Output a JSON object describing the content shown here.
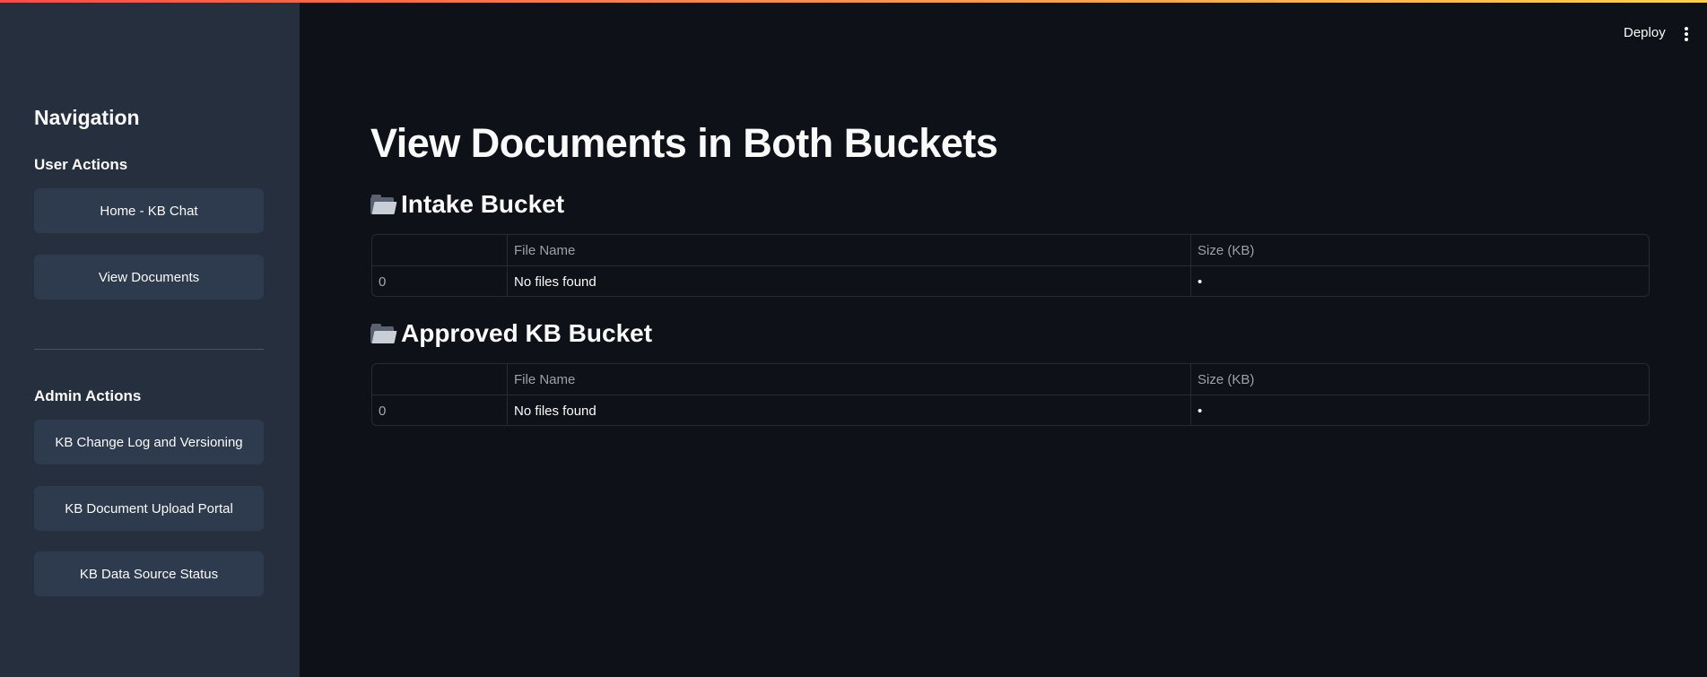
{
  "header": {
    "deploy_label": "Deploy",
    "menu_icon": "kebab-menu-icon"
  },
  "sidebar": {
    "title": "Navigation",
    "user_section": {
      "title": "User Actions",
      "items": [
        {
          "label": "Home - KB Chat"
        },
        {
          "label": "View Documents"
        }
      ]
    },
    "admin_section": {
      "title": "Admin Actions",
      "items": [
        {
          "label": "KB Change Log and Versioning"
        },
        {
          "label": "KB Document Upload Portal"
        },
        {
          "label": "KB Data Source Status"
        }
      ]
    }
  },
  "main": {
    "title": "View Documents in Both Buckets",
    "buckets": [
      {
        "icon": "open-folder-icon",
        "title": "Intake Bucket",
        "columns": [
          "",
          "File Name",
          "Size (KB)"
        ],
        "rows": [
          {
            "index": "0",
            "file_name": "No files found",
            "size": "•"
          }
        ]
      },
      {
        "icon": "open-folder-icon",
        "title": "Approved KB Bucket",
        "columns": [
          "",
          "File Name",
          "Size (KB)"
        ],
        "rows": [
          {
            "index": "0",
            "file_name": "No files found",
            "size": "•"
          }
        ]
      }
    ]
  },
  "colors": {
    "background": "#0e1117",
    "sidebar": "#262f3d",
    "button": "#2e3b4e",
    "accent_gradient_start": "#ff4b4b",
    "accent_gradient_end": "#ffd14b"
  }
}
